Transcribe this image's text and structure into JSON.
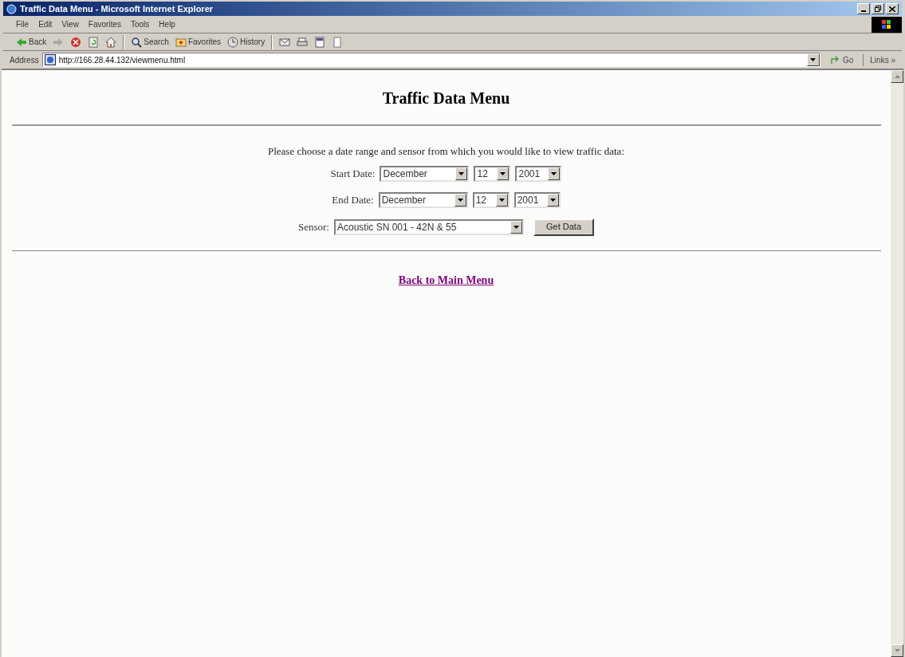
{
  "window": {
    "title": "Traffic Data Menu - Microsoft Internet Explorer"
  },
  "menu": [
    "File",
    "Edit",
    "View",
    "Favorites",
    "Tools",
    "Help"
  ],
  "toolbar": [
    {
      "kind": "back",
      "label": "Back"
    },
    {
      "kind": "forward"
    },
    {
      "kind": "stop"
    },
    {
      "kind": "refresh"
    },
    {
      "kind": "home"
    },
    {
      "kind": "sep"
    },
    {
      "kind": "search",
      "label": "Search"
    },
    {
      "kind": "favorites",
      "label": "Favorites"
    },
    {
      "kind": "history",
      "label": "History"
    },
    {
      "kind": "sep"
    },
    {
      "kind": "mail"
    },
    {
      "kind": "print"
    },
    {
      "kind": "edit"
    },
    {
      "kind": "discuss"
    }
  ],
  "address_bar": {
    "label": "Address",
    "url": "http://166.28.44.132/viewmenu.html",
    "go": "Go",
    "links": "Links »"
  },
  "page": {
    "heading": "Traffic Data Menu",
    "instructions": "Please choose a date range and sensor from which you would like to view traffic data:",
    "rows": [
      {
        "label": "Start Date:",
        "selects": [
          "December",
          "12",
          "2001"
        ]
      },
      {
        "label": "End Date:",
        "selects": [
          "December",
          "12",
          "2001"
        ]
      },
      {
        "label": "Sensor:",
        "selects": [
          "Acoustic SN 001 - 42N & 55"
        ],
        "button": "Get Data"
      }
    ],
    "link": "Back to Main Menu"
  }
}
